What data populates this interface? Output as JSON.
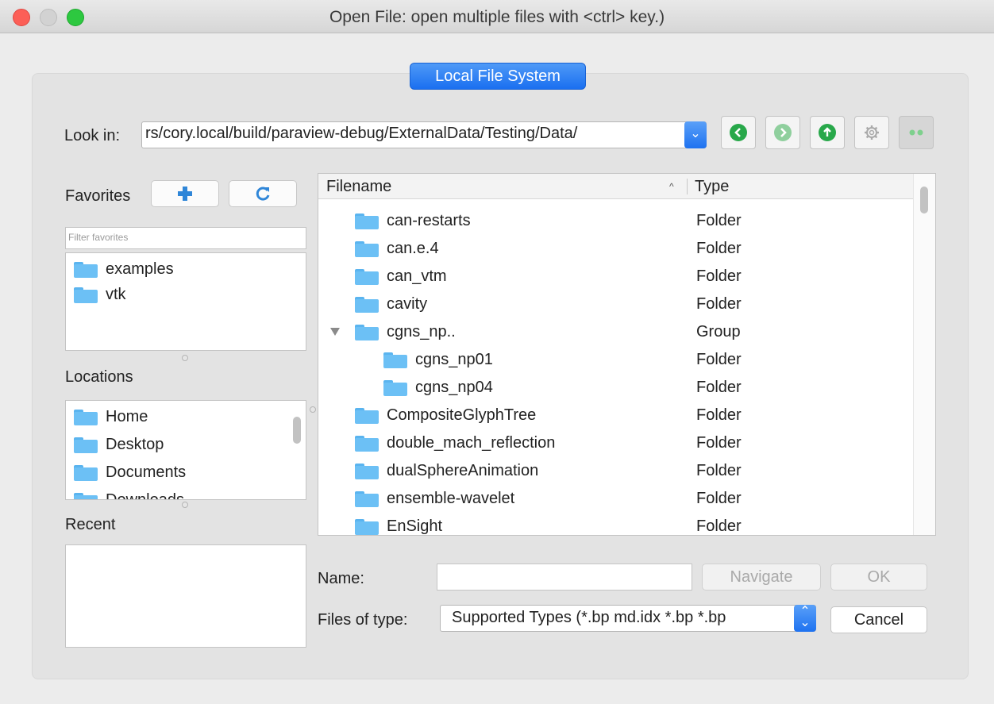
{
  "window": {
    "title": "Open File:  open multiple files with <ctrl> key.)"
  },
  "file_system_tab": {
    "label": "Local File System"
  },
  "look_in": {
    "label": "Look in:",
    "path": "rs/cory.local/build/paraview-debug/ExternalData/Testing/Data/"
  },
  "nav_buttons": [
    {
      "name": "back-icon",
      "enabled": true
    },
    {
      "name": "forward-icon",
      "enabled": false
    },
    {
      "name": "parent-directory-icon",
      "enabled": true
    },
    {
      "name": "settings-icon",
      "enabled": false
    },
    {
      "name": "hidden-files-icon",
      "enabled": true
    }
  ],
  "favorites": {
    "label": "Favorites",
    "filter_placeholder": "Filter favorites",
    "items": [
      "examples",
      "vtk"
    ]
  },
  "locations": {
    "label": "Locations",
    "items": [
      "Home",
      "Desktop",
      "Documents",
      "Downloads"
    ]
  },
  "recent": {
    "label": "Recent",
    "items": []
  },
  "file_list": {
    "columns": [
      "Filename",
      "Type"
    ],
    "rows": [
      {
        "name": "can-restarts",
        "type": "Folder",
        "level": 0,
        "expanded": false
      },
      {
        "name": "can.e.4",
        "type": "Folder",
        "level": 0,
        "expanded": false
      },
      {
        "name": "can_vtm",
        "type": "Folder",
        "level": 0,
        "expanded": false
      },
      {
        "name": "cavity",
        "type": "Folder",
        "level": 0,
        "expanded": false
      },
      {
        "name": "cgns_np..",
        "type": "Group",
        "level": 0,
        "expanded": true
      },
      {
        "name": "cgns_np01",
        "type": "Folder",
        "level": 1,
        "expanded": false
      },
      {
        "name": "cgns_np04",
        "type": "Folder",
        "level": 1,
        "expanded": false
      },
      {
        "name": "CompositeGlyphTree",
        "type": "Folder",
        "level": 0,
        "expanded": false
      },
      {
        "name": "double_mach_reflection",
        "type": "Folder",
        "level": 0,
        "expanded": false
      },
      {
        "name": "dualSphereAnimation",
        "type": "Folder",
        "level": 0,
        "expanded": false
      },
      {
        "name": "ensemble-wavelet",
        "type": "Folder",
        "level": 0,
        "expanded": false
      },
      {
        "name": "EnSight",
        "type": "Folder",
        "level": 0,
        "expanded": false
      }
    ]
  },
  "name_field": {
    "label": "Name:",
    "value": ""
  },
  "navigate_button": {
    "label": "Navigate",
    "enabled": false
  },
  "ok_button": {
    "label": "OK",
    "enabled": false
  },
  "files_of_type": {
    "label": "Files of type:",
    "value": "Supported Types (*.bp md.idx *.bp *.bp"
  },
  "cancel_button": {
    "label": "Cancel"
  },
  "colors": {
    "accent": "#1a6ff0",
    "folder": "#6cc0f5",
    "nav_green": "#28a84a"
  }
}
